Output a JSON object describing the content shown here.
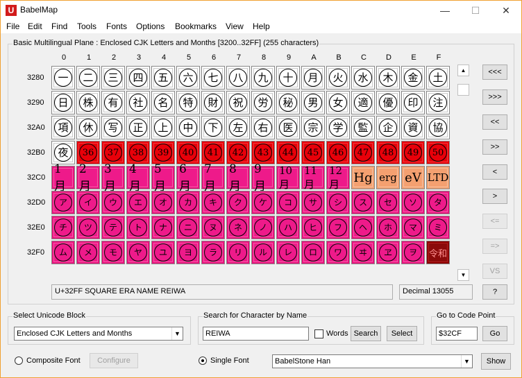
{
  "window": {
    "title": "BabelMap",
    "app_icon_letter": "U"
  },
  "window_controls": {
    "minimize": "—",
    "maximize": "☐",
    "close": "✕"
  },
  "menu": [
    "File",
    "Edit",
    "Find",
    "Tools",
    "Fonts",
    "Options",
    "Bookmarks",
    "View",
    "Help"
  ],
  "grid": {
    "caption": "Basic Multilingual Plane : Enclosed CJK Letters and Months [3200..32FF] (255 characters)",
    "columns": [
      "0",
      "1",
      "2",
      "3",
      "4",
      "5",
      "6",
      "7",
      "8",
      "9",
      "A",
      "B",
      "C",
      "D",
      "E",
      "F"
    ],
    "rows": [
      {
        "label": "3280",
        "cells": [
          {
            "ch": "一",
            "style": "circle"
          },
          {
            "ch": "二",
            "style": "circle"
          },
          {
            "ch": "三",
            "style": "circle"
          },
          {
            "ch": "四",
            "style": "circle"
          },
          {
            "ch": "五",
            "style": "circle"
          },
          {
            "ch": "六",
            "style": "circle"
          },
          {
            "ch": "七",
            "style": "circle"
          },
          {
            "ch": "八",
            "style": "circle"
          },
          {
            "ch": "九",
            "style": "circle"
          },
          {
            "ch": "十",
            "style": "circle"
          },
          {
            "ch": "月",
            "style": "circle"
          },
          {
            "ch": "火",
            "style": "circle"
          },
          {
            "ch": "水",
            "style": "circle"
          },
          {
            "ch": "木",
            "style": "circle"
          },
          {
            "ch": "金",
            "style": "circle"
          },
          {
            "ch": "土",
            "style": "circle"
          }
        ]
      },
      {
        "label": "3290",
        "cells": [
          {
            "ch": "日",
            "style": "circle"
          },
          {
            "ch": "株",
            "style": "circle"
          },
          {
            "ch": "有",
            "style": "circle"
          },
          {
            "ch": "社",
            "style": "circle"
          },
          {
            "ch": "名",
            "style": "circle"
          },
          {
            "ch": "特",
            "style": "circle"
          },
          {
            "ch": "財",
            "style": "circle"
          },
          {
            "ch": "祝",
            "style": "circle"
          },
          {
            "ch": "労",
            "style": "circle"
          },
          {
            "ch": "秘",
            "style": "circle"
          },
          {
            "ch": "男",
            "style": "circle"
          },
          {
            "ch": "女",
            "style": "circle"
          },
          {
            "ch": "適",
            "style": "circle"
          },
          {
            "ch": "優",
            "style": "circle"
          },
          {
            "ch": "印",
            "style": "circle"
          },
          {
            "ch": "注",
            "style": "circle"
          }
        ]
      },
      {
        "label": "32A0",
        "cells": [
          {
            "ch": "項",
            "style": "circle"
          },
          {
            "ch": "休",
            "style": "circle"
          },
          {
            "ch": "写",
            "style": "circle"
          },
          {
            "ch": "正",
            "style": "circle"
          },
          {
            "ch": "上",
            "style": "circle"
          },
          {
            "ch": "中",
            "style": "circle"
          },
          {
            "ch": "下",
            "style": "circle"
          },
          {
            "ch": "左",
            "style": "circle"
          },
          {
            "ch": "右",
            "style": "circle"
          },
          {
            "ch": "医",
            "style": "circle"
          },
          {
            "ch": "宗",
            "style": "circle"
          },
          {
            "ch": "学",
            "style": "circle"
          },
          {
            "ch": "監",
            "style": "circle"
          },
          {
            "ch": "企",
            "style": "circle"
          },
          {
            "ch": "資",
            "style": "circle"
          },
          {
            "ch": "協",
            "style": "circle"
          }
        ]
      },
      {
        "label": "32B0",
        "cells": [
          {
            "ch": "夜",
            "style": "circle"
          },
          {
            "ch": "36",
            "style": "red"
          },
          {
            "ch": "37",
            "style": "red"
          },
          {
            "ch": "38",
            "style": "red"
          },
          {
            "ch": "39",
            "style": "red"
          },
          {
            "ch": "40",
            "style": "red"
          },
          {
            "ch": "41",
            "style": "red"
          },
          {
            "ch": "42",
            "style": "red"
          },
          {
            "ch": "43",
            "style": "red"
          },
          {
            "ch": "44",
            "style": "red"
          },
          {
            "ch": "45",
            "style": "red"
          },
          {
            "ch": "46",
            "style": "red"
          },
          {
            "ch": "47",
            "style": "red"
          },
          {
            "ch": "48",
            "style": "red"
          },
          {
            "ch": "49",
            "style": "red"
          },
          {
            "ch": "50",
            "style": "red"
          }
        ]
      },
      {
        "label": "32C0",
        "cells": [
          {
            "ch": "1月",
            "style": "pink-text"
          },
          {
            "ch": "2月",
            "style": "pink-text"
          },
          {
            "ch": "3月",
            "style": "pink-text"
          },
          {
            "ch": "4月",
            "style": "pink-text"
          },
          {
            "ch": "5月",
            "style": "pink-text"
          },
          {
            "ch": "6月",
            "style": "pink-text"
          },
          {
            "ch": "7月",
            "style": "pink-text"
          },
          {
            "ch": "8月",
            "style": "pink-text"
          },
          {
            "ch": "9月",
            "style": "pink-text"
          },
          {
            "ch": "10月",
            "style": "pink-text"
          },
          {
            "ch": "11月",
            "style": "pink-text"
          },
          {
            "ch": "12月",
            "style": "pink-text"
          },
          {
            "ch": "Hg",
            "style": "orange"
          },
          {
            "ch": "erg",
            "style": "orange"
          },
          {
            "ch": "eV",
            "style": "orange"
          },
          {
            "ch": "LTD",
            "style": "orange"
          }
        ]
      },
      {
        "label": "32D0",
        "cells": [
          {
            "ch": "ア",
            "style": "pink"
          },
          {
            "ch": "イ",
            "style": "pink"
          },
          {
            "ch": "ウ",
            "style": "pink"
          },
          {
            "ch": "エ",
            "style": "pink"
          },
          {
            "ch": "オ",
            "style": "pink"
          },
          {
            "ch": "カ",
            "style": "pink"
          },
          {
            "ch": "キ",
            "style": "pink"
          },
          {
            "ch": "ク",
            "style": "pink"
          },
          {
            "ch": "ケ",
            "style": "pink"
          },
          {
            "ch": "コ",
            "style": "pink"
          },
          {
            "ch": "サ",
            "style": "pink"
          },
          {
            "ch": "シ",
            "style": "pink"
          },
          {
            "ch": "ス",
            "style": "pink"
          },
          {
            "ch": "セ",
            "style": "pink"
          },
          {
            "ch": "ソ",
            "style": "pink"
          },
          {
            "ch": "タ",
            "style": "pink"
          }
        ]
      },
      {
        "label": "32E0",
        "cells": [
          {
            "ch": "チ",
            "style": "pink"
          },
          {
            "ch": "ツ",
            "style": "pink"
          },
          {
            "ch": "テ",
            "style": "pink"
          },
          {
            "ch": "ト",
            "style": "pink"
          },
          {
            "ch": "ナ",
            "style": "pink"
          },
          {
            "ch": "ニ",
            "style": "pink"
          },
          {
            "ch": "ヌ",
            "style": "pink"
          },
          {
            "ch": "ネ",
            "style": "pink"
          },
          {
            "ch": "ノ",
            "style": "pink"
          },
          {
            "ch": "ハ",
            "style": "pink"
          },
          {
            "ch": "ヒ",
            "style": "pink"
          },
          {
            "ch": "フ",
            "style": "pink"
          },
          {
            "ch": "ヘ",
            "style": "pink"
          },
          {
            "ch": "ホ",
            "style": "pink"
          },
          {
            "ch": "マ",
            "style": "pink"
          },
          {
            "ch": "ミ",
            "style": "pink"
          }
        ]
      },
      {
        "label": "32F0",
        "cells": [
          {
            "ch": "ム",
            "style": "pink"
          },
          {
            "ch": "メ",
            "style": "pink"
          },
          {
            "ch": "モ",
            "style": "pink"
          },
          {
            "ch": "ヤ",
            "style": "pink"
          },
          {
            "ch": "ユ",
            "style": "pink"
          },
          {
            "ch": "ヨ",
            "style": "pink"
          },
          {
            "ch": "ラ",
            "style": "pink"
          },
          {
            "ch": "リ",
            "style": "pink"
          },
          {
            "ch": "ル",
            "style": "pink"
          },
          {
            "ch": "レ",
            "style": "pink"
          },
          {
            "ch": "ロ",
            "style": "pink"
          },
          {
            "ch": "ワ",
            "style": "pink"
          },
          {
            "ch": "ヰ",
            "style": "pink"
          },
          {
            "ch": "ヱ",
            "style": "pink"
          },
          {
            "ch": "ヲ",
            "style": "pink"
          },
          {
            "ch": "令和",
            "style": "dark"
          }
        ]
      }
    ]
  },
  "nav_buttons": [
    {
      "label": "<<<",
      "enabled": true
    },
    {
      "label": ">>>",
      "enabled": true
    },
    {
      "label": "<<",
      "enabled": true
    },
    {
      "label": ">>",
      "enabled": true
    },
    {
      "label": "<",
      "enabled": true
    },
    {
      "label": ">",
      "enabled": true
    },
    {
      "label": "<=",
      "enabled": false
    },
    {
      "label": "=>",
      "enabled": false
    },
    {
      "label": "VS",
      "enabled": false
    },
    {
      "label": "?",
      "enabled": true
    }
  ],
  "status": {
    "char_name": "U+32FF SQUARE ERA NAME REIWA",
    "decimal": "Decimal 13055"
  },
  "unicode_block": {
    "group_label": "Select Unicode Block",
    "selected": "Enclosed CJK Letters and Months"
  },
  "search": {
    "group_label": "Search for Character by Name",
    "value": "REIWA",
    "words_label": "Words",
    "words_checked": false,
    "search_button": "Search",
    "select_button": "Select"
  },
  "goto": {
    "group_label": "Go to Code Point",
    "value": "$32CF",
    "button": "Go"
  },
  "font_mode": {
    "composite_label": "Composite Font",
    "configure_button": "Configure",
    "single_label": "Single Font",
    "selected": "single"
  },
  "font": {
    "selected": "BabelStone Han",
    "show_button": "Show"
  }
}
